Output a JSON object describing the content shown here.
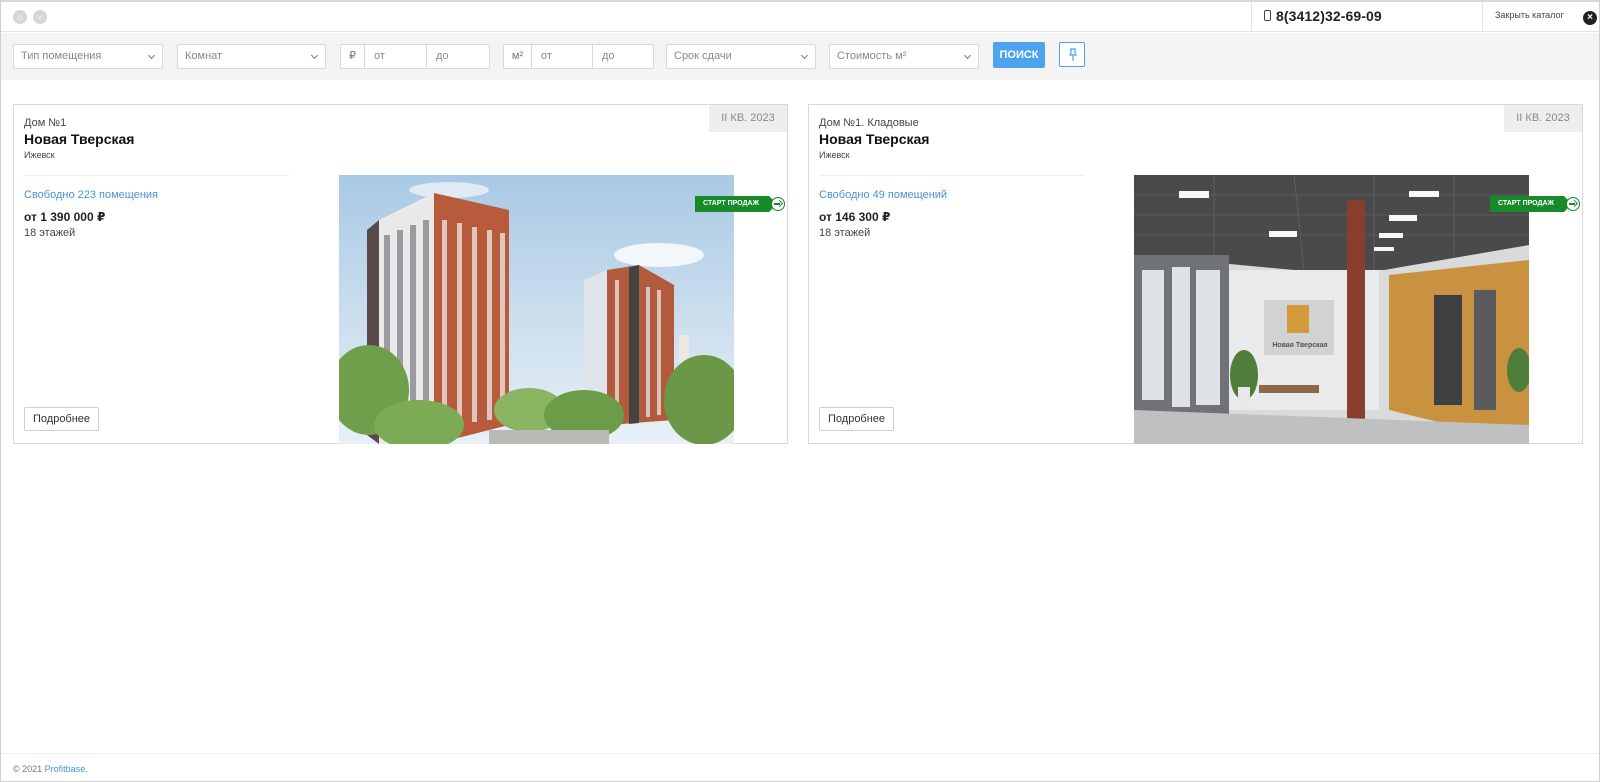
{
  "topbar": {
    "home_icon": "home-icon",
    "back_icon": "back-icon",
    "phone": "8(3412)32-69-09",
    "close_label": "Закрыть каталог"
  },
  "filters": {
    "type_placeholder": "Тип помещения",
    "rooms_placeholder": "Комнат",
    "price_unit": "₽",
    "price_from": "от",
    "price_to": "до",
    "area_unit": "м²",
    "area_from": "от",
    "area_to": "до",
    "deadline_placeholder": "Срок сдачи",
    "sqm_price_placeholder": "Стоимость м²",
    "search_label": "ПОИСК"
  },
  "cards": [
    {
      "house": "Дом №1",
      "title": "Новая Тверская",
      "city": "Ижевск",
      "quarter": "II КВ. 2023",
      "free": "Свободно 223 помещения",
      "price": "от 1 390 000 ₽",
      "floors": "18 этажей",
      "badge": "СТАРТ ПРОДАЖ",
      "more": "Подробнее"
    },
    {
      "house": "Дом №1. Кладовые",
      "title": "Новая Тверская",
      "city": "Ижевск",
      "quarter": "II КВ. 2023",
      "free": "Свободно 49 помещений",
      "price": "от 146 300 ₽",
      "floors": "18 этажей",
      "badge": "СТАРТ ПРОДАЖ",
      "more": "Подробнее",
      "sign_text": "Новая Тверская"
    }
  ],
  "footer": {
    "copyright": "© 2021",
    "brand": "Profitbase."
  },
  "colors": {
    "accent": "#4da3f0",
    "link": "#4a90d9",
    "badge": "#178a2a"
  }
}
